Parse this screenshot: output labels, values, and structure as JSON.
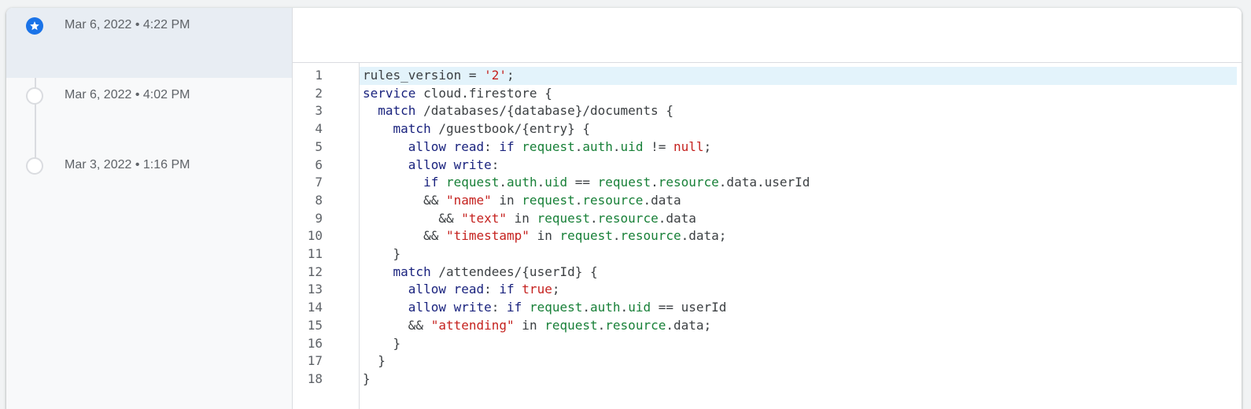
{
  "history": {
    "entries": [
      {
        "label": "Mar 6, 2022 • 4:22 PM",
        "active": true,
        "icon": "star-icon"
      },
      {
        "label": "Mar 6, 2022 • 4:02 PM",
        "active": false,
        "icon": "circle-icon"
      },
      {
        "label": "Mar 3, 2022 • 1:16 PM",
        "active": false,
        "icon": "circle-icon"
      }
    ]
  },
  "editor": {
    "highlighted_line": 1,
    "lines": [
      [
        {
          "t": "rules_version = ",
          "c": "op"
        },
        {
          "t": "'2'",
          "c": "str"
        },
        {
          "t": ";",
          "c": "op"
        }
      ],
      [
        {
          "t": "service",
          "c": "kw"
        },
        {
          "t": " cloud.firestore {",
          "c": "op"
        }
      ],
      [
        {
          "t": "  match",
          "c": "kw"
        },
        {
          "t": " /databases/{database}/documents {",
          "c": "op"
        }
      ],
      [
        {
          "t": "    match",
          "c": "kw"
        },
        {
          "t": " /guestbook/{entry} {",
          "c": "op"
        }
      ],
      [
        {
          "t": "      allow read",
          "c": "kw"
        },
        {
          "t": ": ",
          "c": "op"
        },
        {
          "t": "if",
          "c": "kw"
        },
        {
          "t": " ",
          "c": "op"
        },
        {
          "t": "request",
          "c": "id"
        },
        {
          "t": ".",
          "c": "op"
        },
        {
          "t": "auth",
          "c": "id"
        },
        {
          "t": ".",
          "c": "op"
        },
        {
          "t": "uid",
          "c": "id"
        },
        {
          "t": " != ",
          "c": "op"
        },
        {
          "t": "null",
          "c": "lit"
        },
        {
          "t": ";",
          "c": "op"
        }
      ],
      [
        {
          "t": "      allow write",
          "c": "kw"
        },
        {
          "t": ":",
          "c": "op"
        }
      ],
      [
        {
          "t": "        if",
          "c": "kw"
        },
        {
          "t": " ",
          "c": "op"
        },
        {
          "t": "request",
          "c": "id"
        },
        {
          "t": ".",
          "c": "op"
        },
        {
          "t": "auth",
          "c": "id"
        },
        {
          "t": ".",
          "c": "op"
        },
        {
          "t": "uid",
          "c": "id"
        },
        {
          "t": " == ",
          "c": "op"
        },
        {
          "t": "request",
          "c": "id"
        },
        {
          "t": ".",
          "c": "op"
        },
        {
          "t": "resource",
          "c": "id"
        },
        {
          "t": ".data.userId",
          "c": "op"
        }
      ],
      [
        {
          "t": "        && ",
          "c": "op"
        },
        {
          "t": "\"name\"",
          "c": "str"
        },
        {
          "t": " in ",
          "c": "op"
        },
        {
          "t": "request",
          "c": "id"
        },
        {
          "t": ".",
          "c": "op"
        },
        {
          "t": "resource",
          "c": "id"
        },
        {
          "t": ".data",
          "c": "op"
        }
      ],
      [
        {
          "t": "          && ",
          "c": "op"
        },
        {
          "t": "\"text\"",
          "c": "str"
        },
        {
          "t": " in ",
          "c": "op"
        },
        {
          "t": "request",
          "c": "id"
        },
        {
          "t": ".",
          "c": "op"
        },
        {
          "t": "resource",
          "c": "id"
        },
        {
          "t": ".data",
          "c": "op"
        }
      ],
      [
        {
          "t": "        && ",
          "c": "op"
        },
        {
          "t": "\"timestamp\"",
          "c": "str"
        },
        {
          "t": " in ",
          "c": "op"
        },
        {
          "t": "request",
          "c": "id"
        },
        {
          "t": ".",
          "c": "op"
        },
        {
          "t": "resource",
          "c": "id"
        },
        {
          "t": ".data;",
          "c": "op"
        }
      ],
      [
        {
          "t": "    }",
          "c": "op"
        }
      ],
      [
        {
          "t": "    match",
          "c": "kw"
        },
        {
          "t": " /attendees/{userId} {",
          "c": "op"
        }
      ],
      [
        {
          "t": "      allow read",
          "c": "kw"
        },
        {
          "t": ": ",
          "c": "op"
        },
        {
          "t": "if",
          "c": "kw"
        },
        {
          "t": " ",
          "c": "op"
        },
        {
          "t": "true",
          "c": "lit"
        },
        {
          "t": ";",
          "c": "op"
        }
      ],
      [
        {
          "t": "      allow write",
          "c": "kw"
        },
        {
          "t": ": ",
          "c": "op"
        },
        {
          "t": "if",
          "c": "kw"
        },
        {
          "t": " ",
          "c": "op"
        },
        {
          "t": "request",
          "c": "id"
        },
        {
          "t": ".",
          "c": "op"
        },
        {
          "t": "auth",
          "c": "id"
        },
        {
          "t": ".",
          "c": "op"
        },
        {
          "t": "uid",
          "c": "id"
        },
        {
          "t": " == userId",
          "c": "op"
        }
      ],
      [
        {
          "t": "      && ",
          "c": "op"
        },
        {
          "t": "\"attending\"",
          "c": "str"
        },
        {
          "t": " in ",
          "c": "op"
        },
        {
          "t": "request",
          "c": "id"
        },
        {
          "t": ".",
          "c": "op"
        },
        {
          "t": "resource",
          "c": "id"
        },
        {
          "t": ".data;",
          "c": "op"
        }
      ],
      [
        {
          "t": "    }",
          "c": "op"
        }
      ],
      [
        {
          "t": "  }",
          "c": "op"
        }
      ],
      [
        {
          "t": "}",
          "c": "op"
        }
      ]
    ],
    "line_numbers": [
      "1",
      "2",
      "3",
      "4",
      "5",
      "6",
      "7",
      "8",
      "9",
      "10",
      "11",
      "12",
      "13",
      "14",
      "15",
      "16",
      "17",
      "18"
    ]
  },
  "colors": {
    "accent": "#1a73e8",
    "keyword": "#1a237e",
    "identifier": "#188038",
    "string": "#c5221f",
    "line_highlight": "#e3f3fb"
  }
}
